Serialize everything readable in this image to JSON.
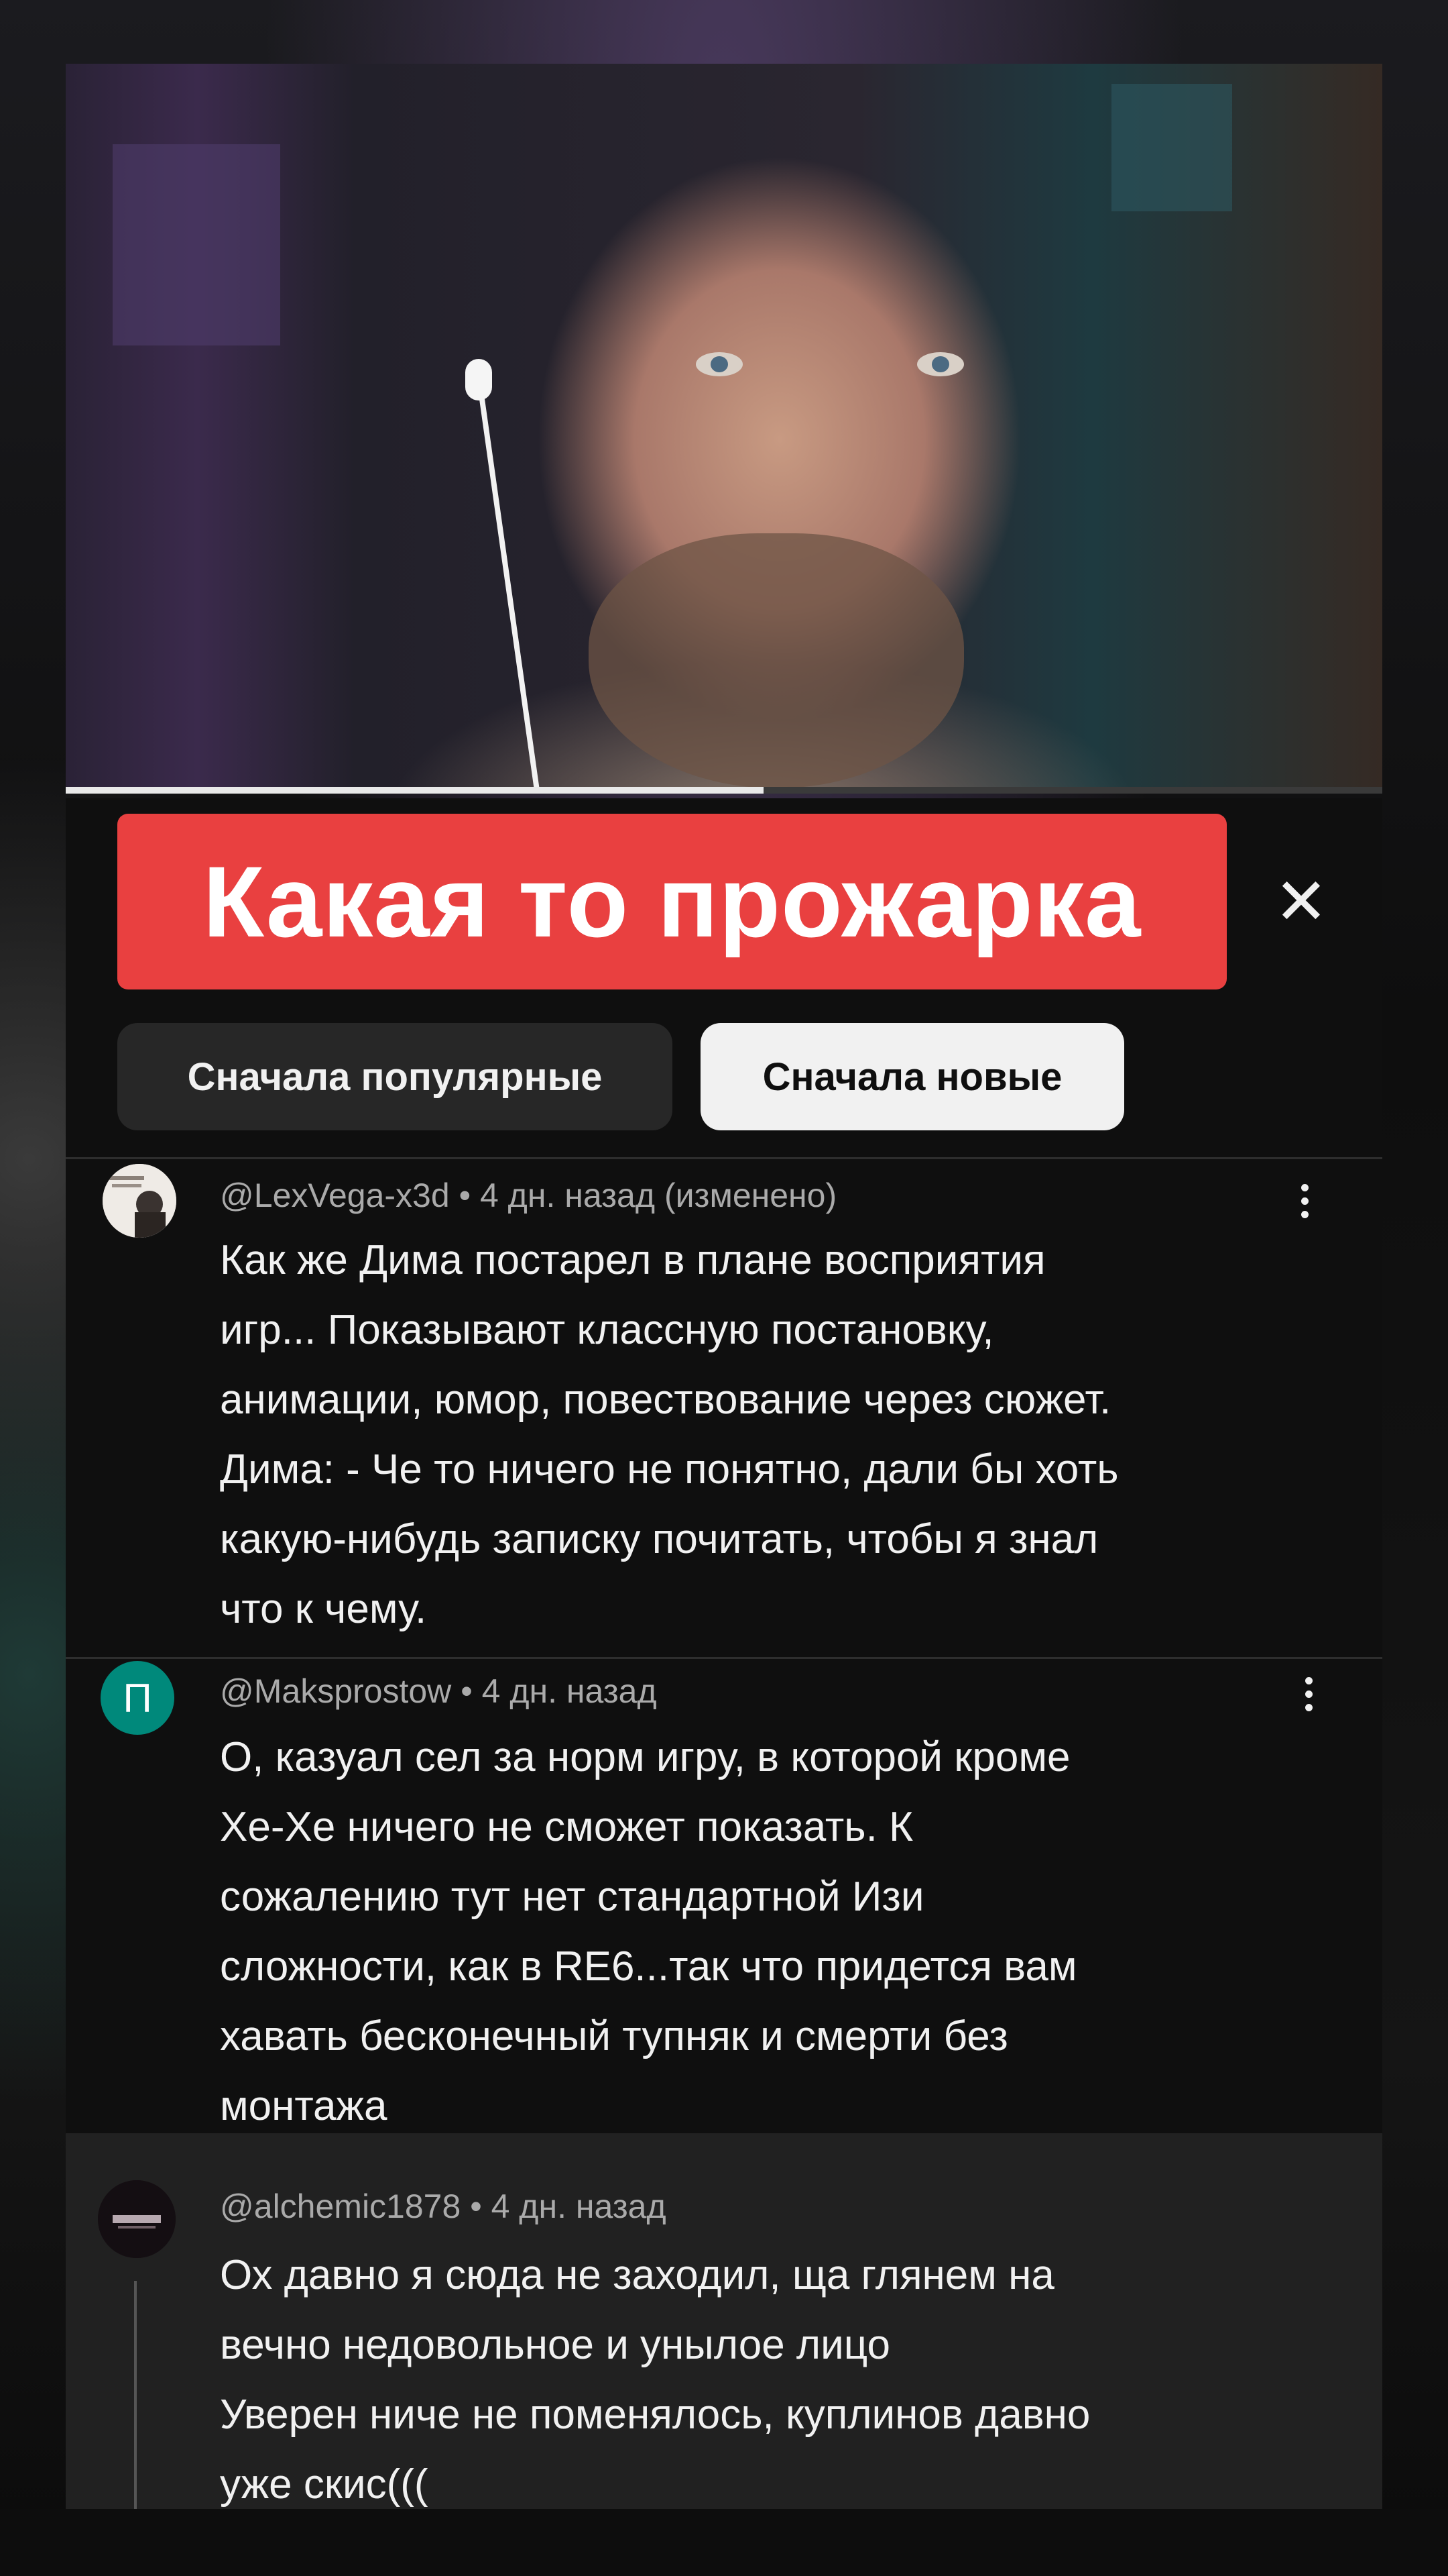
{
  "title_banner": "Какая то прожарка",
  "video": {
    "progress": 0.53
  },
  "sort_chips": [
    {
      "label": "Сначала популярные",
      "selected": false
    },
    {
      "label": "Сначала новые",
      "selected": true
    }
  ],
  "comments": [
    {
      "author": "@LexVega-x3d",
      "time": "4 дн. назад",
      "edited": "(изменено)",
      "text": "Как же Дима постарел в плане восприятия\nигр... Показывают классную постановку,\nанимации, юмор, повествование через сюжет.\nДима: - Че то ничего не понятно, дали бы хоть\nкакую-нибудь записку почитать, чтобы я знал\nчто к чему."
    },
    {
      "author": "@Maksprostow",
      "avatar_letter": "П",
      "time": "4 дн. назад",
      "text": "О, казуал сел за норм игру, в которой кроме\nХе-Хе ничего не сможет показать. К\nсожалению тут нет стандартной Изи\nсложности, как в RE6...так что придется вам\nхавать бесконечный тупняк и смерти без\nмонтажа"
    },
    {
      "author": "@alchemic1878",
      "time": "4 дн. назад",
      "text": "Ох давно я сюда не заходил, ща глянем на\nвечно недовольное и унылое лицо\nУверен ниче не поменялось, куплинов давно\nуже скис((("
    }
  ],
  "separator": "•",
  "colors": {
    "banner": "#e94040",
    "teal_avatar": "#00897b",
    "sheet": "#0f0f0f"
  },
  "icons": [
    "close-icon",
    "more-vert-icon"
  ]
}
